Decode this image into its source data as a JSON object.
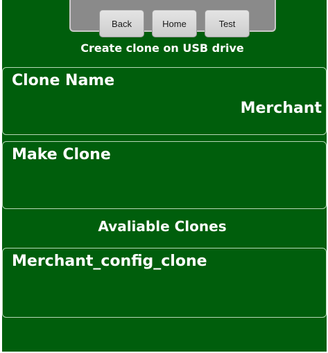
{
  "nav": {
    "back_label": "Back",
    "home_label": "Home",
    "test_label": "Test"
  },
  "header": {
    "title": "Create clone on USB drive"
  },
  "clone_name": {
    "label": "Clone Name",
    "value": "Merchant"
  },
  "make_clone": {
    "label": "Make Clone"
  },
  "available_clones": {
    "heading": "Avaliable Clones",
    "items": [
      {
        "name": "Merchant_config_clone"
      }
    ]
  }
}
